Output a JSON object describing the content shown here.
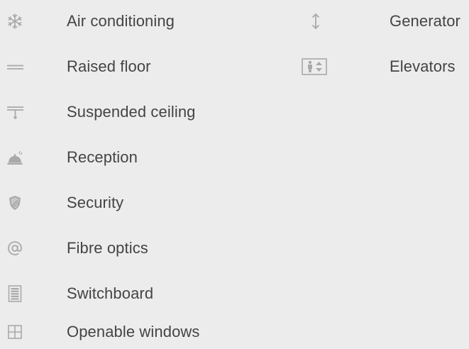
{
  "amenities": {
    "left": [
      {
        "label": "Air conditioning",
        "icon": "snowflake-icon"
      },
      {
        "label": "Raised floor",
        "icon": "raised-floor-icon"
      },
      {
        "label": "Suspended ceiling",
        "icon": "suspended-ceiling-icon"
      },
      {
        "label": "Reception",
        "icon": "reception-bell-icon"
      },
      {
        "label": "Security",
        "icon": "security-shield-icon"
      },
      {
        "label": "Fibre optics",
        "icon": "at-sign-icon"
      },
      {
        "label": "Switchboard",
        "icon": "switchboard-icon"
      },
      {
        "label": "Openable windows",
        "icon": "window-icon"
      }
    ],
    "right": [
      {
        "label": "Generator",
        "icon": "vertical-arrows-icon"
      },
      {
        "label": "Elevators",
        "icon": "elevator-icon"
      }
    ]
  },
  "colors": {
    "background": "#ececec",
    "text": "#444444",
    "icon": "#a9a9a9"
  }
}
